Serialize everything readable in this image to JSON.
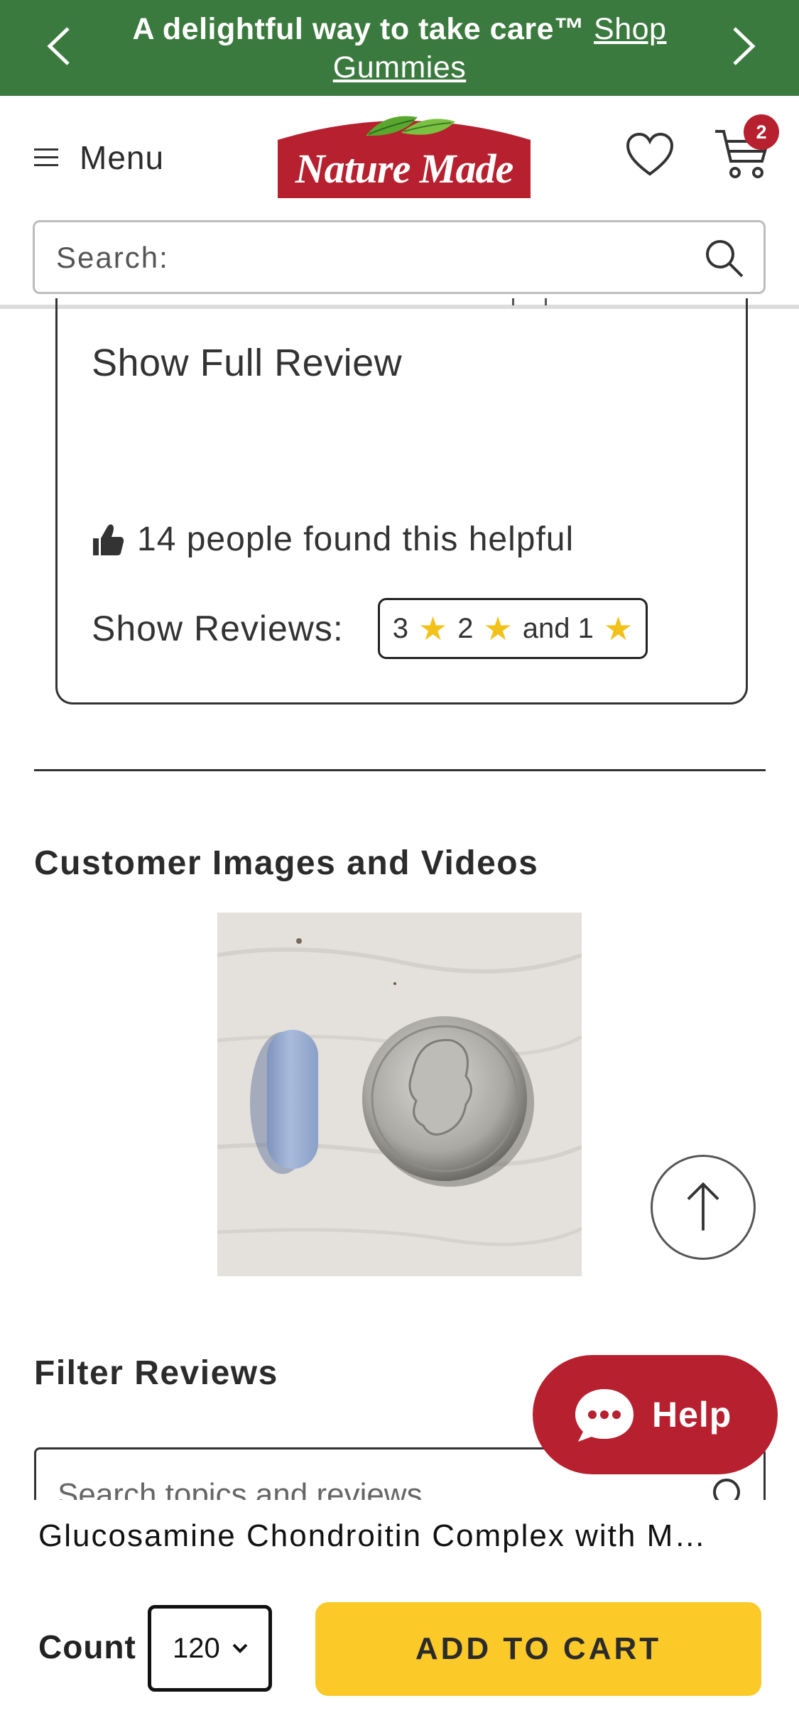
{
  "promo": {
    "text": "A delightful way to take care™",
    "link": "Shop Gummies"
  },
  "header": {
    "menu_label": "Menu",
    "logo_text": "Nature Made",
    "cart_count": "2",
    "search_placeholder": "Search:"
  },
  "review": {
    "show_full_label": "Show Full Review",
    "helpful_text": "14 people found this helpful",
    "show_reviews_label": "Show Reviews:",
    "filter": {
      "a": "3",
      "b": "2",
      "and": "and 1"
    }
  },
  "customer_media": {
    "title": "Customer Images and Videos"
  },
  "filter_reviews": {
    "title": "Filter Reviews",
    "search_placeholder": "Search topics and reviews"
  },
  "help": {
    "label": "Help"
  },
  "sticky_bar": {
    "product_name": "Glucosamine Chondroitin Complex with M…",
    "count_label": "Count",
    "count_value": "120",
    "add_to_cart_label": "ADD TO CART"
  },
  "colors": {
    "brand_green": "#3b7a3e",
    "brand_red": "#b7202e",
    "cta_yellow": "#fbc928",
    "star_yellow": "#f3c21a"
  }
}
